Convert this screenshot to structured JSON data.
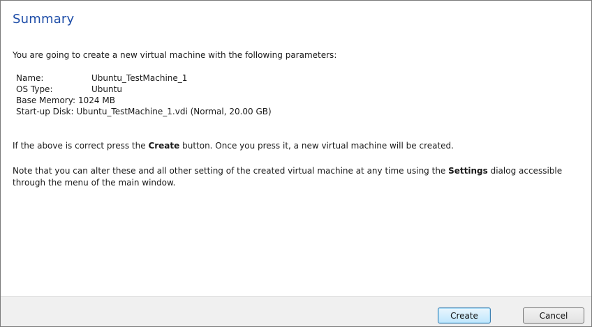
{
  "summary": {
    "title": "Summary",
    "intro": "You are going to create a new virtual machine with the following parameters:"
  },
  "params": [
    {
      "label": "Name:",
      "value": "Ubuntu_TestMachine_1"
    },
    {
      "label": "OS Type:",
      "value": "Ubuntu"
    },
    {
      "label": "Base Memory:",
      "value": "1024 MB"
    },
    {
      "label": "Start-up Disk:",
      "value": "Ubuntu_TestMachine_1.vdi (Normal, 20.00 GB)"
    }
  ],
  "create_note": {
    "before": "If the above is correct press the ",
    "bold": "Create",
    "after": " button. Once you press it, a new virtual machine will be created."
  },
  "settings_note": {
    "before": "Note that you can alter these and all other setting of the created virtual machine at any time using the ",
    "bold": "Settings",
    "after": " dialog accessible through the menu of the main window."
  },
  "buttons": {
    "create": "Create",
    "cancel": "Cancel"
  }
}
